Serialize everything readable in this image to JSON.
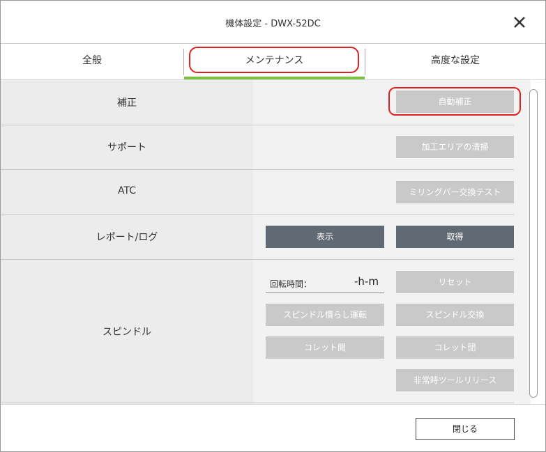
{
  "window": {
    "title": "機体設定 - DWX-52DC"
  },
  "tabs": [
    {
      "label": "全般"
    },
    {
      "label": "メンテナンス"
    },
    {
      "label": "高度な設定"
    }
  ],
  "rows": {
    "correction": {
      "label": "補正",
      "auto_button": "自動補正"
    },
    "support": {
      "label": "サポート",
      "clean_button": "加工エリアの清掃"
    },
    "atc": {
      "label": "ATC",
      "milling_bar_button": "ミリングバー交換テスト"
    },
    "report": {
      "label": "レポート/ログ",
      "show_button": "表示",
      "get_button": "取得"
    },
    "spindle": {
      "label": "スピンドル",
      "rotation_label": "回転時間：",
      "rotation_value": "-h-m",
      "reset_button": "リセット",
      "break_in_button": "スピンドル慣らし運転",
      "replace_button": "スピンドル交換",
      "collet_open_button": "コレット開",
      "collet_close_button": "コレット閉",
      "emergency_release_button": "非常時ツールリリース"
    }
  },
  "footer": {
    "close_button": "閉じる"
  },
  "colors": {
    "accent_green": "#7ac142",
    "highlight_red": "#e02020",
    "dark_button": "#616a72",
    "disabled_button": "#c9c9c9"
  },
  "icons": {
    "close": "close-icon"
  }
}
